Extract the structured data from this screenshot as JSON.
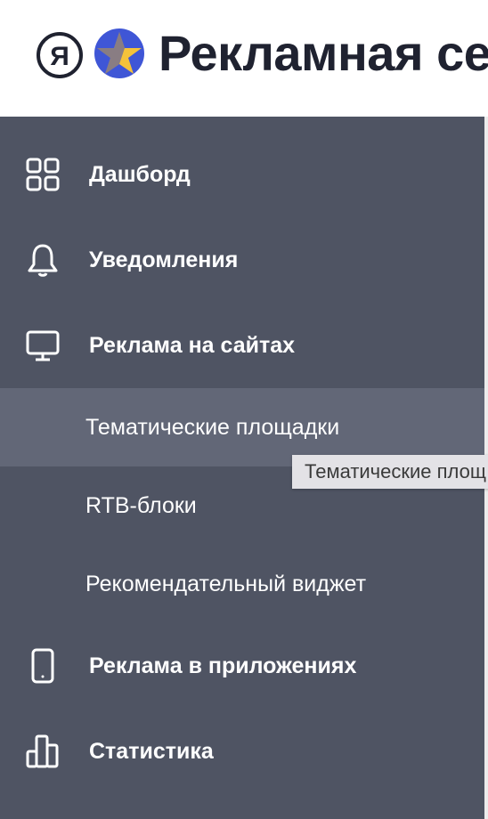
{
  "header": {
    "brand_title": "Рекламная сет",
    "logo_letter": "Я"
  },
  "sidebar": {
    "items": [
      {
        "label": "Дашборд",
        "icon": "dashboard-grid-icon"
      },
      {
        "label": "Уведомления",
        "icon": "bell-icon"
      },
      {
        "label": "Реклама на сайтах",
        "icon": "monitor-icon"
      },
      {
        "label": "Реклама в приложениях",
        "icon": "mobile-phone-icon"
      },
      {
        "label": "Статистика",
        "icon": "bar-chart-icon"
      }
    ],
    "subitems": [
      {
        "label": "Тематические площадки",
        "active": true
      },
      {
        "label": "RTB-блоки",
        "active": false
      },
      {
        "label": "Рекомендательный виджет",
        "active": false
      }
    ]
  },
  "tooltip": {
    "text": "Тематические площ"
  },
  "colors": {
    "sidebar_bg": "#4f5463",
    "active_bg": "#626777",
    "brand_text": "#1f2230",
    "tooltip_bg": "#e3e2e6"
  }
}
